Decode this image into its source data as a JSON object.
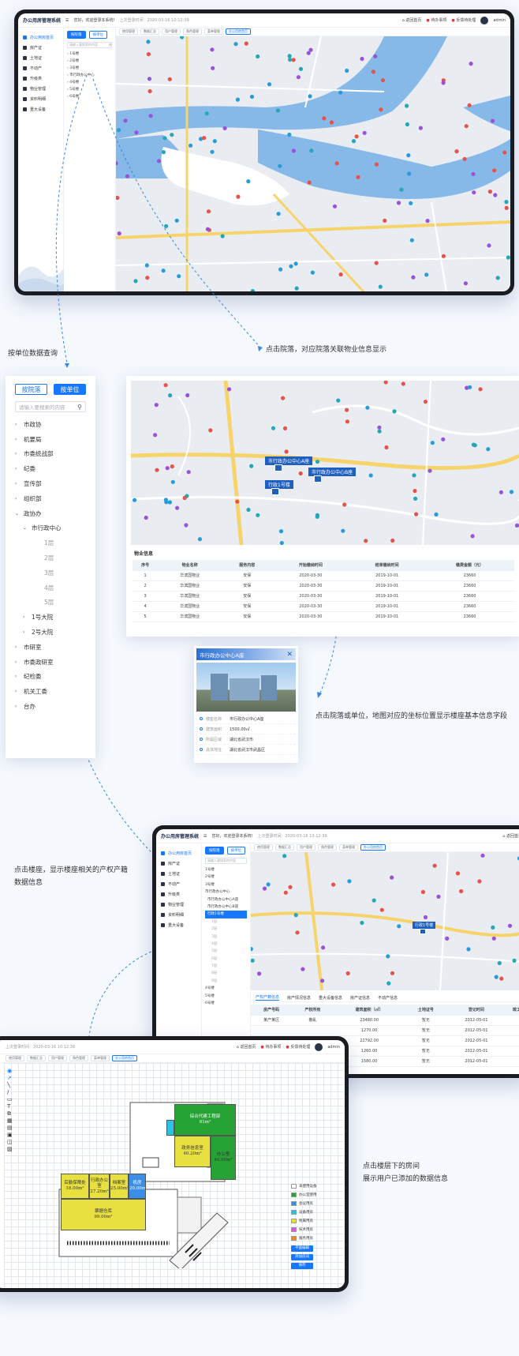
{
  "app": {
    "title": "办公用房管理系统",
    "welcome": "您好，欢迎登录本系统!",
    "last_login": "上次登录时间：2020-03-16 10:12:39",
    "home": "返回首页",
    "todo": "待办事项",
    "feedback": "反馈待处理",
    "user": "admin"
  },
  "tabs": [
    "使用管理",
    "数据汇总",
    "用户管理",
    "角色管理",
    "菜单管理",
    "办公用房首页"
  ],
  "sidebar": [
    "办公用房首页",
    "房产证",
    "土地证",
    "不动产",
    "升级类",
    "物业管理",
    "资料明细",
    "重大设备"
  ],
  "tree_buttons": {
    "by_courtyard": "按院落",
    "by_unit": "按单位"
  },
  "screen1_tree": [
    "1号楼",
    "2号楼",
    "3号楼",
    "市行政办公中心",
    "4号楼",
    "5号楼",
    "6号楼"
  ],
  "captions": {
    "unit_query": "按单位数据查询",
    "courtyard_click": "点击院落，对应院落关联物业信息显示",
    "unit_click": "点击院落或单位，地图对应的坐标位置显示楼座基本信息字段",
    "building_click_1": "点击楼座，显示楼座相关的产权产籍",
    "building_click_2": "数据信息",
    "room_click_1": "点击楼层下的房间",
    "room_click_2": "展示用户已添加的数据信息"
  },
  "big_tree": {
    "search_placeholder": "请输入要搜索的内容",
    "nodes": [
      {
        "label": "市政协",
        "level": 0,
        "caret": "›"
      },
      {
        "label": "机要局",
        "level": 0,
        "caret": "›"
      },
      {
        "label": "市委统战部",
        "level": 0,
        "caret": "›"
      },
      {
        "label": "纪委",
        "level": 0,
        "caret": "›"
      },
      {
        "label": "宣传部",
        "level": 0,
        "caret": "›"
      },
      {
        "label": "组织部",
        "level": 0,
        "caret": "›"
      },
      {
        "label": "政协办",
        "level": 0,
        "caret": "⌄"
      },
      {
        "label": "市行政中心",
        "level": 1,
        "caret": "⌄"
      },
      {
        "label": "1层",
        "level": 2,
        "caret": ""
      },
      {
        "label": "2层",
        "level": 2,
        "caret": ""
      },
      {
        "label": "3层",
        "level": 2,
        "caret": ""
      },
      {
        "label": "4层",
        "level": 2,
        "caret": ""
      },
      {
        "label": "5层",
        "level": 2,
        "caret": ""
      },
      {
        "label": "1号大院",
        "level": 1,
        "caret": "›"
      },
      {
        "label": "2号大院",
        "level": 1,
        "caret": "›"
      },
      {
        "label": "市研室",
        "level": 0,
        "caret": "›"
      },
      {
        "label": "市委政研室",
        "level": 0,
        "caret": "›"
      },
      {
        "label": "纪检委",
        "level": 0,
        "caret": "›"
      },
      {
        "label": "机关工委",
        "level": 0,
        "caret": "›"
      },
      {
        "label": "台办",
        "level": 0,
        "caret": "›"
      }
    ]
  },
  "map_labels": {
    "center_a": "市行政办公中心A座",
    "center_b": "市行政办公中心B座",
    "building_1": "行政1号楼"
  },
  "property_table": {
    "title": "物业信息",
    "headers": [
      "序号",
      "物业名称",
      "服务内容",
      "开始缴纳时间",
      "结束缴纳时间",
      "缴费金额（元）"
    ],
    "rows": [
      [
        "1",
        "华滨国物业",
        "安保",
        "2020-03-30",
        "2019-10-01",
        "23660"
      ],
      [
        "2",
        "华滨国物业",
        "安保",
        "2020-03-30",
        "2019-10-01",
        "23660"
      ],
      [
        "3",
        "华滨国物业",
        "安保",
        "2020-03-30",
        "2019-10-01",
        "23660"
      ],
      [
        "4",
        "华滨国物业",
        "安保",
        "2020-03-30",
        "2019-10-01",
        "23660"
      ],
      [
        "5",
        "华滨国物业",
        "安保",
        "2020-03-30",
        "2019-10-01",
        "23660"
      ]
    ]
  },
  "info_card": {
    "title": "市行政办公中心A座",
    "fields": [
      {
        "k": "楼座名称",
        "v": "市行政办公中心A座"
      },
      {
        "k": "建筑面积",
        "v": "1500.00㎡"
      },
      {
        "k": "所属区域",
        "v": "湖北省武汉市"
      },
      {
        "k": "具体地址",
        "v": "湖北省武汉市武昌区"
      }
    ]
  },
  "screen3": {
    "tree": [
      "1号楼",
      "2号楼",
      "3号楼",
      "市行政办公中心",
      "市行政办公中心A座",
      "市行政办公中心B座",
      "行政1号楼",
      "1层",
      "2层",
      "3层",
      "4层",
      "5层",
      "6层",
      "7层",
      "8层",
      "9层",
      "4号楼",
      "5号楼",
      "6号楼"
    ],
    "table_tabs": [
      "产权产籍信息",
      "房产情况信息",
      "重大设备信息",
      "房产证信息",
      "不动产信息"
    ],
    "headers": [
      "房产号码",
      "产权所有",
      "建筑面积（㎡）",
      "土地证号",
      "登记时间",
      "竣工"
    ],
    "rows": [
      [
        "某产某区",
        "散乱",
        "23480.00",
        "暂无",
        "2012-05-01"
      ],
      [
        "",
        "",
        "1270.00",
        "暂无",
        "2012-05-01"
      ],
      [
        "",
        "",
        "22792.00",
        "暂无",
        "2012-05-01"
      ],
      [
        "",
        "",
        "1260.00",
        "暂无",
        "2012-05-01"
      ],
      [
        "",
        "",
        "1580.00",
        "暂无",
        "2012-05-01"
      ]
    ]
  },
  "floorplan": {
    "rooms": [
      {
        "name": "综合代建工程部",
        "area": "61m²"
      },
      {
        "name": "政务信息室",
        "area": "40.20m²"
      },
      {
        "name": "办公室",
        "area": "40.00m²"
      },
      {
        "name": "后勤保障处",
        "area": "18.00m²"
      },
      {
        "name": "行政办公室",
        "area": "27.20m²"
      },
      {
        "name": "档案室",
        "area": "25.00m²"
      },
      {
        "name": "机房",
        "area": "20.00m²"
      },
      {
        "name": "票据仓库",
        "area": "99.00m²"
      }
    ],
    "legend": [
      "未使用设备",
      "办公室使用",
      "会议用房",
      "设备用房",
      "附属用房",
      "技术用房",
      "服务用房"
    ],
    "legend_colors": [
      "#ffffff",
      "#27a235",
      "#3a8ee6",
      "#27c4e6",
      "#e8e041",
      "#e055d6",
      "#f08a24"
    ],
    "buttons": [
      "平面编辑",
      "添加房间",
      "保存"
    ]
  },
  "colors": {
    "accent": "#1677ff",
    "water": "#86b8e8",
    "land": "#e9edf2"
  }
}
